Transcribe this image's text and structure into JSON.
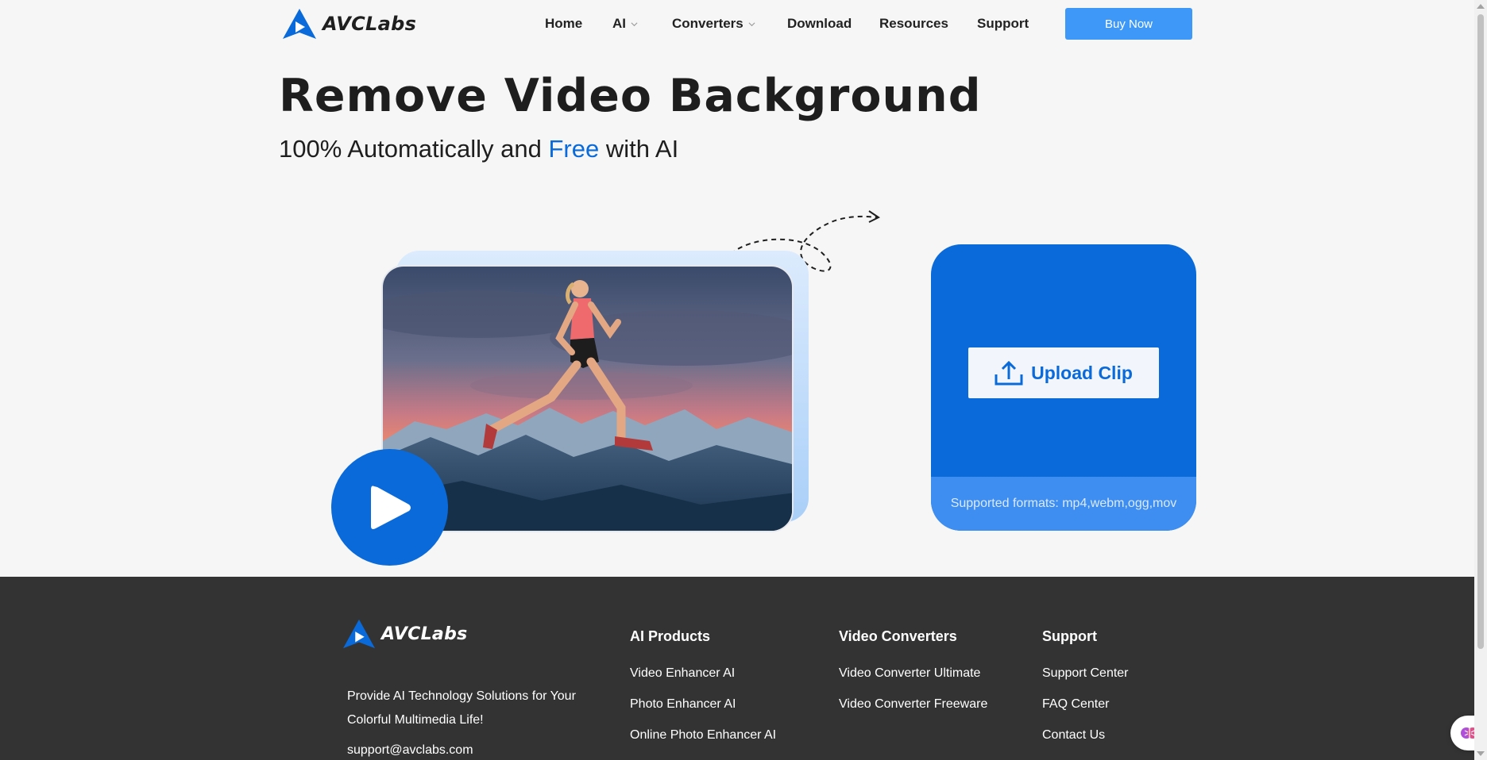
{
  "header": {
    "brand": "AVCLabs",
    "nav": [
      {
        "label": "Home",
        "dropdown": false
      },
      {
        "label": "AI",
        "dropdown": true
      },
      {
        "label": "Converters",
        "dropdown": true
      },
      {
        "label": "Download",
        "dropdown": false
      },
      {
        "label": "Resources",
        "dropdown": false
      },
      {
        "label": "Support",
        "dropdown": false
      }
    ],
    "buy_label": "Buy Now"
  },
  "hero": {
    "title": "Remove Video Background",
    "subtitle_pre": "100% Automatically and ",
    "subtitle_accent": "Free",
    "subtitle_post": " with AI"
  },
  "upload": {
    "button_label": "Upload Clip",
    "formats": "Supported formats: mp4,webm,ogg,mov"
  },
  "footer": {
    "brand": "AVCLabs",
    "tagline": "Provide AI Technology Solutions for Your Colorful Multimedia Life!",
    "email": "support@avclabs.com",
    "columns": [
      {
        "title": "AI Products",
        "links": [
          "Video Enhancer AI",
          "Photo Enhancer AI",
          "Online Photo Enhancer AI"
        ]
      },
      {
        "title": "Video Converters",
        "links": [
          "Video Converter Ultimate",
          "Video Converter Freeware"
        ]
      },
      {
        "title": "Support",
        "links": [
          "Support Center",
          "FAQ Center",
          "Contact Us"
        ]
      }
    ]
  },
  "colors": {
    "brand_blue": "#0a6ad9",
    "buy_button": "#3d98f8",
    "footer_bg": "#333333",
    "page_bg": "#f6f6f6"
  },
  "icons": [
    "avclabs-logo-icon",
    "chevron-down-icon",
    "play-icon",
    "upload-icon",
    "dashed-arrow-icon",
    "brain-assistant-icon"
  ]
}
